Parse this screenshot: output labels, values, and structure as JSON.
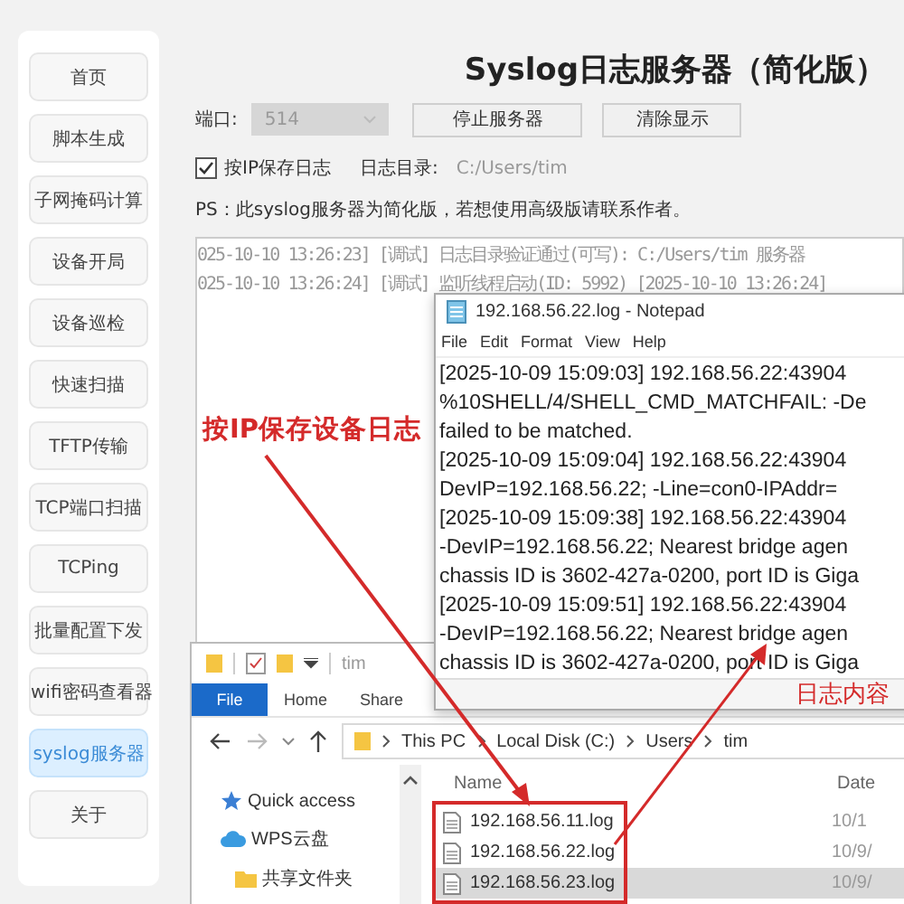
{
  "sidebar": {
    "items": [
      {
        "label": "首页",
        "selected": false
      },
      {
        "label": "脚本生成",
        "selected": false
      },
      {
        "label": "子网掩码计算",
        "selected": false
      },
      {
        "label": "设备开局",
        "selected": false
      },
      {
        "label": "设备巡检",
        "selected": false
      },
      {
        "label": "快速扫描",
        "selected": false
      },
      {
        "label": "TFTP传输",
        "selected": false
      },
      {
        "label": "TCP端口扫描",
        "selected": false
      },
      {
        "label": "TCPing",
        "selected": false
      },
      {
        "label": "批量配置下发",
        "selected": false
      },
      {
        "label": "wifi密码查看器",
        "selected": false
      },
      {
        "label": "syslog服务器",
        "selected": true
      },
      {
        "label": "关于",
        "selected": false
      }
    ]
  },
  "title": "Syslog日志服务器（简化版）",
  "port": {
    "label": "端口:",
    "value": "514",
    "disabled": true
  },
  "buttons": [
    "停止服务器",
    "清除显示"
  ],
  "save_by_ip": {
    "label": "按IP保存日志",
    "checked": true
  },
  "log_dir": {
    "label": "日志目录:",
    "value": "C:/Users/tim"
  },
  "note": "PS：此syslog服务器为简化版，若想使用高级版请联系作者。",
  "log_lines": [
    "025-10-10 13:26:23] [调试] 日志目录验证通过(可写): C:/Users/tim 服务器",
    "025-10-10 13:26:24] [调试] 监听线程启动(ID: 5992) [2025-10-10 13:26:24]"
  ],
  "notepad": {
    "title": "192.168.56.22.log - Notepad",
    "menu": [
      "File",
      "Edit",
      "Format",
      "View",
      "Help"
    ],
    "lines": [
      "[2025-10-09 15:09:03] 192.168.56.22:43904",
      "%10SHELL/4/SHELL_CMD_MATCHFAIL: -De",
      "failed to be matched.",
      "[2025-10-09 15:09:04] 192.168.56.22:43904",
      "DevIP=192.168.56.22; -Line=con0-IPAddr=",
      "[2025-10-09 15:09:38] 192.168.56.22:43904",
      "-DevIP=192.168.56.22; Nearest bridge agen",
      "chassis ID is 3602-427a-0200, port ID is Giga",
      "[2025-10-09 15:09:51] 192.168.56.22:43904",
      "-DevIP=192.168.56.22; Nearest bridge agen",
      "chassis ID is 3602-427a-0200, port ID is Giga"
    ]
  },
  "explorer": {
    "title": "tim",
    "tabs": [
      {
        "label": "File",
        "selected": true
      },
      {
        "label": "Home",
        "selected": false
      },
      {
        "label": "Share",
        "selected": false
      }
    ],
    "path": [
      "This PC",
      "Local Disk (C:)",
      "Users",
      "tim"
    ],
    "nav": [
      {
        "label": "Quick access",
        "kind": "star"
      },
      {
        "label": "WPS云盘",
        "kind": "cloud"
      },
      {
        "label": "共享文件夹",
        "kind": "folder"
      }
    ],
    "columns": [
      "Name",
      "Date"
    ],
    "files": [
      {
        "name": "192.168.56.11.log",
        "date": "10/1",
        "selected": false
      },
      {
        "name": "192.168.56.22.log",
        "date": "10/9/",
        "selected": false
      },
      {
        "name": "192.168.56.23.log",
        "date": "10/9/",
        "selected": true
      }
    ]
  },
  "annotations": [
    "按IP保存设备日志",
    "日志内容"
  ]
}
